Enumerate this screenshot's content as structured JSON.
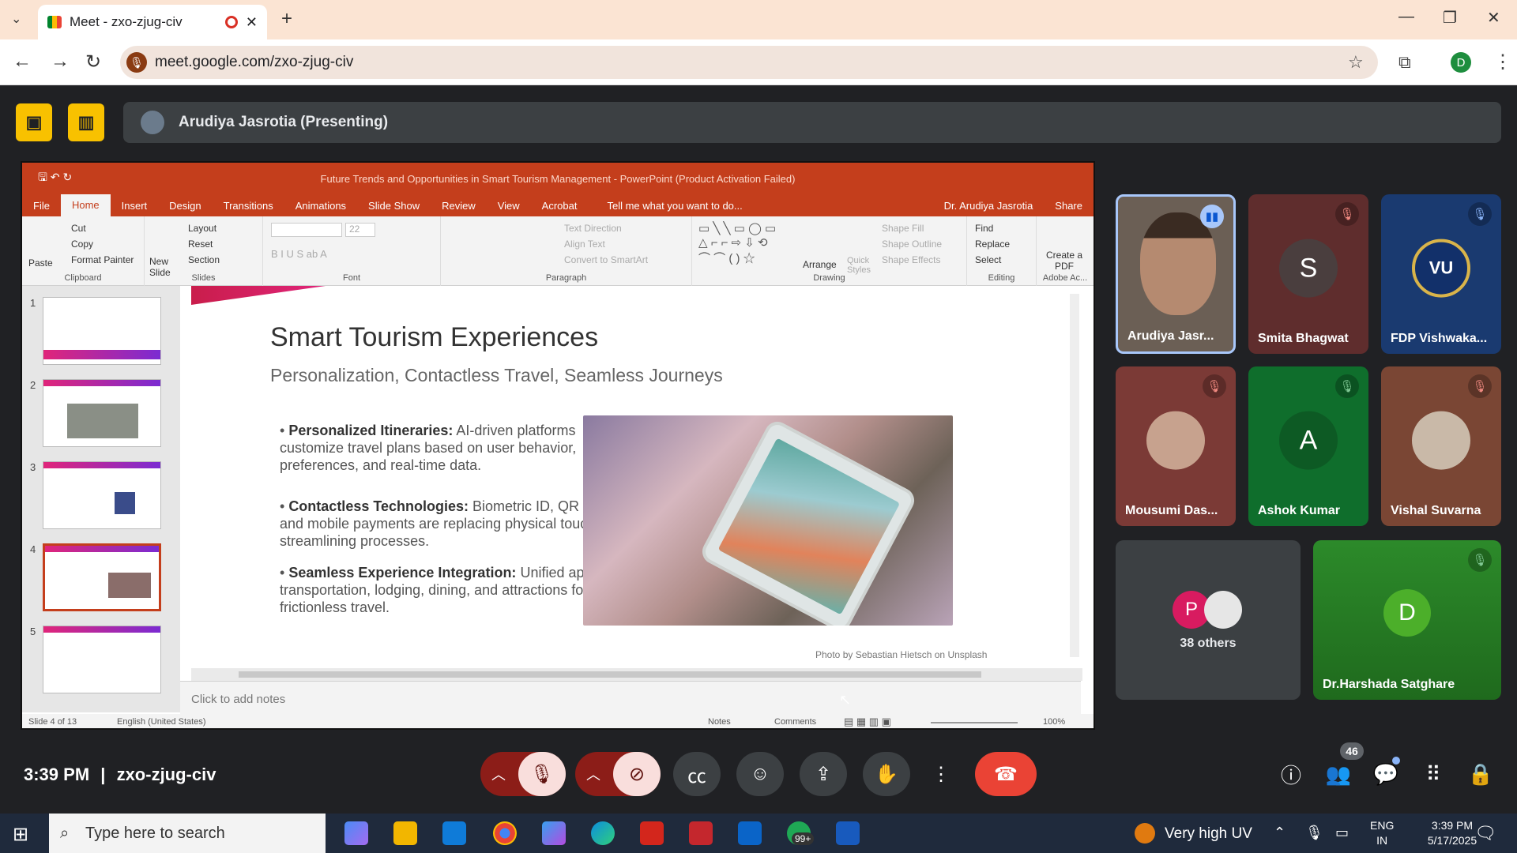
{
  "browser": {
    "tab_title": "Meet - zxo-zjug-civ",
    "url": "meet.google.com/zxo-zjug-civ",
    "profile_initial": "D",
    "new_tab_icon": "plus-icon"
  },
  "meet": {
    "presenter_label": "Arudiya Jasrotia (Presenting)",
    "time": "3:39 PM",
    "separator": "|",
    "meeting_code": "zxo-zjug-civ",
    "participant_count": "46"
  },
  "powerpoint": {
    "title": "Future Trends and Opportunities in Smart Tourism Management  -  PowerPoint (Product Activation Failed)",
    "user": "Dr. Arudiya Jasrotia",
    "share_label": "Share",
    "tell_me": "Tell me what you want to do...",
    "tabs": [
      "File",
      "Home",
      "Insert",
      "Design",
      "Transitions",
      "Animations",
      "Slide Show",
      "Review",
      "View",
      "Acrobat"
    ],
    "ribbon": {
      "clipboard": {
        "label": "Clipboard",
        "paste": "Paste",
        "cut": "Cut",
        "copy": "Copy",
        "format_painter": "Format Painter"
      },
      "slides": {
        "label": "Slides",
        "new_slide": "New Slide",
        "layout": "Layout",
        "reset": "Reset",
        "section": "Section"
      },
      "font": {
        "label": "Font",
        "size": "22"
      },
      "paragraph": {
        "label": "Paragraph",
        "text_direction": "Text Direction",
        "align_text": "Align Text",
        "convert": "Convert to SmartArt"
      },
      "drawing": {
        "label": "Drawing",
        "arrange": "Arrange",
        "quick_styles": "Quick Styles",
        "shape_fill": "Shape Fill",
        "shape_outline": "Shape Outline",
        "shape_effects": "Shape Effects"
      },
      "editing": {
        "label": "Editing",
        "find": "Find",
        "replace": "Replace",
        "select": "Select"
      },
      "adobe": {
        "label": "Adobe Ac...",
        "create_pdf": "Create a PDF"
      }
    },
    "slide_numbers": [
      "1",
      "2",
      "3",
      "4",
      "5"
    ],
    "slide": {
      "title": "Smart Tourism Experiences",
      "subtitle": "Personalization, Contactless Travel, Seamless Journeys",
      "bullets": [
        {
          "head": "Personalized Itineraries:",
          "text": " AI-driven platforms customize travel plans based on user behavior, preferences, and real-time data."
        },
        {
          "head": "Contactless Technologies:",
          "text": " Biometric ID, QR codes, and mobile payments are replacing physical touchpoints, streamlining processes."
        },
        {
          "head": "Seamless Experience Integration:",
          "text": " Unified apps link transportation, lodging, dining, and attractions for frictionless travel."
        }
      ],
      "photo_credit": "Photo by Sebastian Hietsch on Unsplash"
    },
    "notes_placeholder": "Click to add notes",
    "status": {
      "slide_of": "Slide 4 of 13",
      "language": "English (United States)",
      "notes": "Notes",
      "comments": "Comments",
      "zoom": "100%"
    }
  },
  "participants": [
    {
      "name": "Arudiya Jasr...",
      "type": "video"
    },
    {
      "name": "Smita Bhagwat",
      "initial": "S",
      "color": "#5f2d2d"
    },
    {
      "name": "FDP Vishwaka...",
      "initial": "VU",
      "color": "#1a3a70"
    },
    {
      "name": "Mousumi Das...",
      "color": "#7b3a36"
    },
    {
      "name": "Ashok Kumar",
      "initial": "A",
      "color": "#0f6e2c"
    },
    {
      "name": "Vishal Suvarna",
      "color": "#7a4634"
    }
  ],
  "others": {
    "label": "38 others",
    "initials": [
      "P"
    ]
  },
  "featured": {
    "name": "Dr.Harshada Satghare",
    "initial": "D"
  },
  "taskbar": {
    "search_placeholder": "Type here to search",
    "whatsapp_badge": "99+",
    "weather": "Very high UV",
    "lang_top": "ENG",
    "lang_bottom": "IN",
    "time": "3:39 PM",
    "date": "5/17/2025"
  },
  "colors": {
    "accent": "#f8c100",
    "hangup": "#ea4335",
    "ppt": "#c43e1c"
  }
}
